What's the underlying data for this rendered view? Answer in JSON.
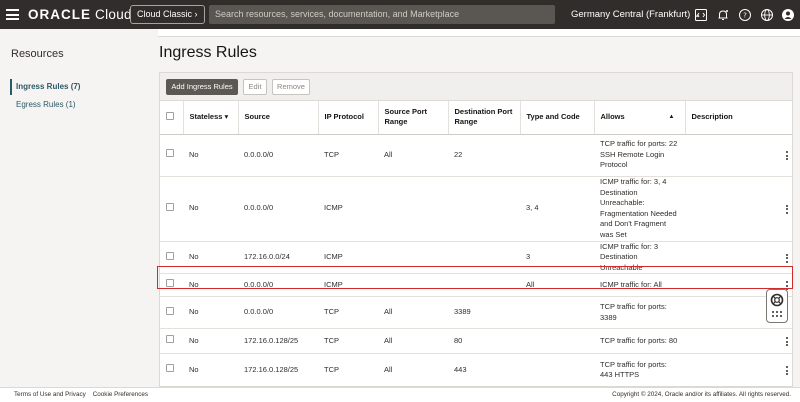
{
  "topbar": {
    "logo_brand": "ORACLE",
    "logo_product": " Cloud",
    "classic_label": "Cloud Classic",
    "search_placeholder": "Search resources, services, documentation, and Marketplace",
    "region": "Germany Central (Frankfurt)"
  },
  "sidebar": {
    "title": "Resources",
    "items": [
      {
        "label": "Ingress Rules (7)"
      },
      {
        "label": "Egress Rules (1)"
      }
    ]
  },
  "page": {
    "title": "Ingress Rules"
  },
  "toolbar": {
    "add_label": "Add Ingress Rules",
    "edit_label": "Edit",
    "remove_label": "Remove"
  },
  "table": {
    "columns": [
      "Stateless",
      "Source",
      "IP Protocol",
      "Source Port Range",
      "Destination Port Range",
      "Type and Code",
      "Allows",
      "Description"
    ],
    "rows": [
      {
        "stateless": "No",
        "source": "0.0.0.0/0",
        "protocol": "TCP",
        "src_port": "All",
        "dst_port": "22",
        "type_code": "",
        "allows": "TCP traffic for ports: 22 SSH Remote Login Protocol",
        "description": ""
      },
      {
        "stateless": "No",
        "source": "0.0.0.0/0",
        "protocol": "ICMP",
        "src_port": "",
        "dst_port": "",
        "type_code": "3, 4",
        "allows": "ICMP traffic for: 3, 4 Destination Unreachable: Fragmentation Needed and Don't Fragment was Set",
        "description": ""
      },
      {
        "stateless": "No",
        "source": "172.16.0.0/24",
        "protocol": "ICMP",
        "src_port": "",
        "dst_port": "",
        "type_code": "3",
        "allows": "ICMP traffic for: 3 Destination Unreachable",
        "description": ""
      },
      {
        "stateless": "No",
        "source": "0.0.0.0/0",
        "protocol": "ICMP",
        "src_port": "",
        "dst_port": "",
        "type_code": "All",
        "allows": "ICMP traffic for: All",
        "description": ""
      },
      {
        "stateless": "No",
        "source": "0.0.0.0/0",
        "protocol": "TCP",
        "src_port": "All",
        "dst_port": "3389",
        "type_code": "",
        "allows": "TCP traffic for ports: 3389",
        "description": ""
      },
      {
        "stateless": "No",
        "source": "172.16.0.128/25",
        "protocol": "TCP",
        "src_port": "All",
        "dst_port": "80",
        "type_code": "",
        "allows": "TCP traffic for ports: 80",
        "description": ""
      },
      {
        "stateless": "No",
        "source": "172.16.0.128/25",
        "protocol": "TCP",
        "src_port": "All",
        "dst_port": "443",
        "type_code": "",
        "allows": "TCP traffic for ports: 443 HTTPS",
        "description": ""
      }
    ]
  },
  "footer": {
    "terms": "Terms of Use and Privacy",
    "cookies": "Cookie Preferences",
    "copyright": "Copyright © 2024, Oracle and/or its affiliates. All rights reserved."
  },
  "colors": {
    "topbar": "#312d2a",
    "link": "#2c5967",
    "highlight": "#d02a2a"
  }
}
